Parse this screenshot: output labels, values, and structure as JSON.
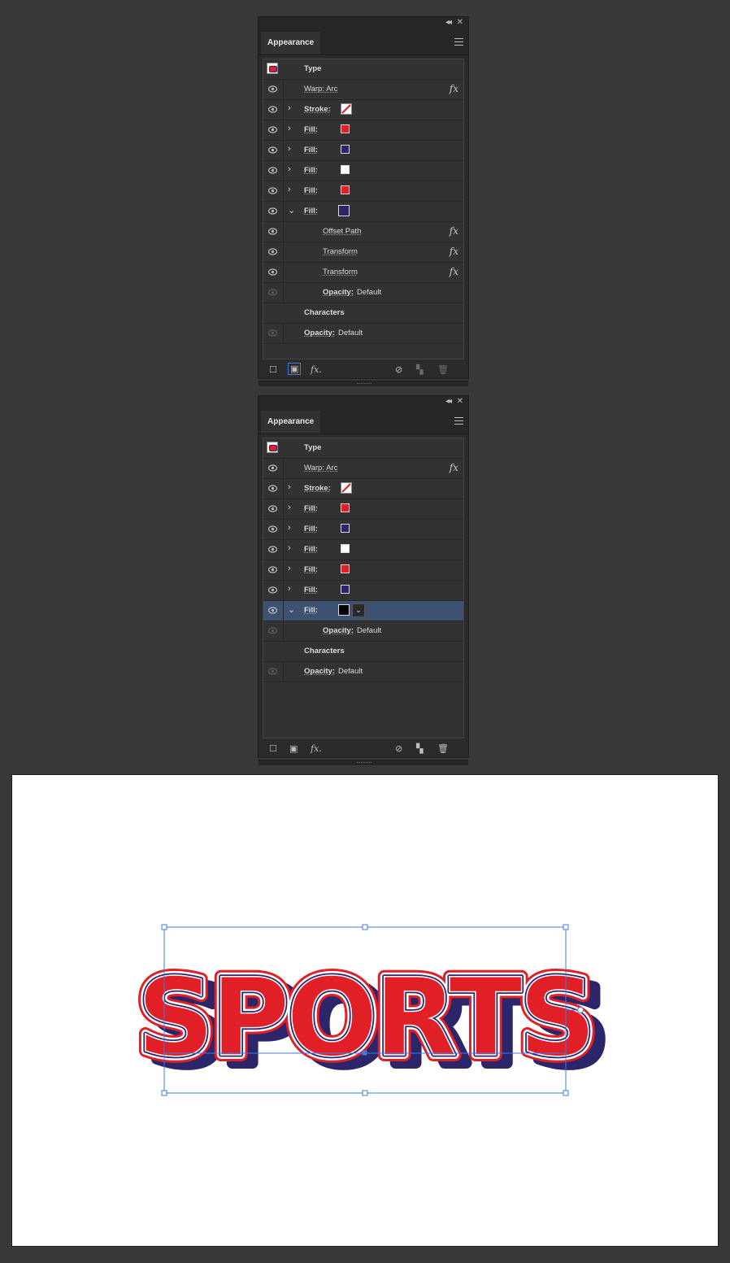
{
  "panel1": {
    "tab": "Appearance",
    "rows": [
      {
        "kind": "thumb",
        "label": "Type"
      },
      {
        "kind": "attr",
        "label": "Warp: Arc",
        "fx": true
      },
      {
        "kind": "attr",
        "label": "Stroke:",
        "chev": "›",
        "swatch": "none"
      },
      {
        "kind": "attr",
        "label": "Fill:",
        "chev": "›",
        "swatch": "#e11f26"
      },
      {
        "kind": "attr",
        "label": "Fill:",
        "chev": "›",
        "swatch": "#2b2569"
      },
      {
        "kind": "attr",
        "label": "Fill:",
        "chev": "›",
        "swatch": "#ffffff"
      },
      {
        "kind": "attr",
        "label": "Fill:",
        "chev": "›",
        "swatch": "#e11f26"
      },
      {
        "kind": "attr",
        "label": "Fill:",
        "chev": "⌄",
        "swatch": "#2b2569",
        "swatchBig": true
      },
      {
        "kind": "effect",
        "label": "Offset Path",
        "fx": true
      },
      {
        "kind": "effect",
        "label": "Transform",
        "fx": true
      },
      {
        "kind": "effect",
        "label": "Transform",
        "fx": true
      },
      {
        "kind": "effect-op",
        "label": "Opacity:",
        "value": "Default",
        "dim": true
      },
      {
        "kind": "chars",
        "label": "Characters"
      },
      {
        "kind": "op",
        "label": "Opacity:",
        "value": "Default",
        "dim": true
      }
    ]
  },
  "panel2": {
    "tab": "Appearance",
    "rows": [
      {
        "kind": "thumb",
        "label": "Type"
      },
      {
        "kind": "attr",
        "label": "Warp: Arc",
        "fx": true
      },
      {
        "kind": "attr",
        "label": "Stroke:",
        "chev": "›",
        "swatch": "none"
      },
      {
        "kind": "attr",
        "label": "Fill:",
        "chev": "›",
        "swatch": "#e11f26"
      },
      {
        "kind": "attr",
        "label": "Fill:",
        "chev": "›",
        "swatch": "#2b2569"
      },
      {
        "kind": "attr",
        "label": "Fill:",
        "chev": "›",
        "swatch": "#ffffff"
      },
      {
        "kind": "attr",
        "label": "Fill:",
        "chev": "›",
        "swatch": "#e11f26"
      },
      {
        "kind": "attr",
        "label": "Fill:",
        "chev": "›",
        "swatch": "#2b2569"
      },
      {
        "kind": "attr",
        "label": "Fill:",
        "chev": "⌄",
        "swatch": "#000000",
        "swatchBig": true,
        "dropdown": true,
        "selected": true
      },
      {
        "kind": "effect-op",
        "label": "Opacity:",
        "value": "Default",
        "dim": true
      },
      {
        "kind": "chars",
        "label": "Characters"
      },
      {
        "kind": "op",
        "label": "Opacity:",
        "value": "Default",
        "dim": true
      }
    ]
  },
  "artwork": {
    "text": "SPORTS",
    "colors": {
      "red": "#e11f26",
      "navy": "#2b2569",
      "white": "#ffffff",
      "selection": "#3d7be0"
    }
  }
}
